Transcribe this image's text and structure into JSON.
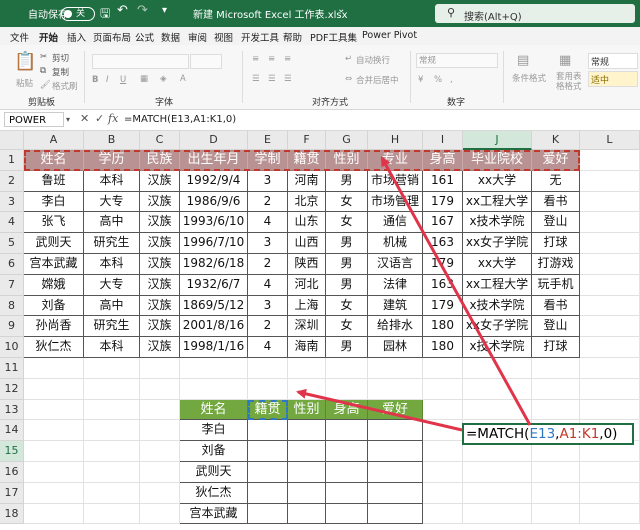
{
  "titlebar": {
    "autosave_label": "自动保存",
    "toggle_state": "关",
    "filename": "新建 Microsoft Excel 工作表.xlsx",
    "search_placeholder": "搜索(Alt+Q)"
  },
  "menu": [
    "文件",
    "开始",
    "插入",
    "页面布局",
    "公式",
    "数据",
    "审阅",
    "视图",
    "开发工具",
    "帮助",
    "PDF工具集",
    "Power Pivot"
  ],
  "ribbon": {
    "paste_label": "粘贴",
    "cut_label": "剪切",
    "copy_label": "复制",
    "format_painter_label": "格式刷",
    "clipboard_group": "剪贴板",
    "font_group": "字体",
    "align_group": "对齐方式",
    "number_group": "数字",
    "wrap_label": "自动换行",
    "merge_label": "合并后居中",
    "number_format": "常规",
    "cond_format_label": "条件格式",
    "table_format_label": "套用表格格式",
    "style_normal": "常规",
    "style_medium": "适中"
  },
  "formula_bar": {
    "name_box": "POWER",
    "formula": "=MATCH(E13,A1:K1,0)"
  },
  "columns": [
    "A",
    "B",
    "C",
    "D",
    "E",
    "F",
    "G",
    "H",
    "I",
    "J",
    "K",
    "L"
  ],
  "rows": [
    "1",
    "2",
    "3",
    "4",
    "5",
    "6",
    "7",
    "8",
    "9",
    "10",
    "11",
    "12",
    "13",
    "14",
    "15",
    "16",
    "17",
    "18"
  ],
  "table1": {
    "headers": [
      "姓名",
      "学历",
      "民族",
      "出生年月",
      "学制",
      "籍贯",
      "性别",
      "专业",
      "身高",
      "毕业院校",
      "爱好"
    ],
    "rows": [
      [
        "鲁班",
        "本科",
        "汉族",
        "1992/9/4",
        "3",
        "河南",
        "男",
        "市场营销",
        "161",
        "xx大学",
        "无"
      ],
      [
        "李白",
        "大专",
        "汉族",
        "1986/9/6",
        "2",
        "北京",
        "女",
        "市场管理",
        "179",
        "xx工程大学",
        "看书"
      ],
      [
        "张飞",
        "高中",
        "汉族",
        "1993/6/10",
        "4",
        "山东",
        "女",
        "通信",
        "167",
        "x技术学院",
        "登山"
      ],
      [
        "武则天",
        "研究生",
        "汉族",
        "1996/7/10",
        "3",
        "山西",
        "男",
        "机械",
        "163",
        "xx女子学院",
        "打球"
      ],
      [
        "宫本武藏",
        "本科",
        "汉族",
        "1982/6/18",
        "2",
        "陕西",
        "男",
        "汉语言",
        "179",
        "xx大学",
        "打游戏"
      ],
      [
        "嫦娥",
        "大专",
        "汉族",
        "1932/6/7",
        "4",
        "河北",
        "男",
        "法律",
        "163",
        "xx工程大学",
        "玩手机"
      ],
      [
        "刘备",
        "高中",
        "汉族",
        "1869/5/12",
        "3",
        "上海",
        "女",
        "建筑",
        "179",
        "x技术学院",
        "看书"
      ],
      [
        "孙尚香",
        "研究生",
        "汉族",
        "2001/8/16",
        "2",
        "深圳",
        "女",
        "给排水",
        "180",
        "xx女子学院",
        "登山"
      ],
      [
        "狄仁杰",
        "本科",
        "汉族",
        "1998/1/16",
        "4",
        "海南",
        "男",
        "园林",
        "180",
        "x技术学院",
        "打球"
      ]
    ]
  },
  "table2": {
    "headers": [
      "姓名",
      "籍贯",
      "性别",
      "身高",
      "爱好"
    ],
    "names": [
      "李白",
      "刘备",
      "武则天",
      "狄仁杰",
      "宫本武藏"
    ]
  },
  "edit_cell": {
    "prefix": "=MATCH(",
    "ref1": "E13",
    "comma": ",",
    "ref2": "A1:K1",
    "suffix": ",0)"
  },
  "colors": {
    "brand_green": "#1f6f43",
    "header_mauve": "#b99394",
    "header_green": "#72a83f",
    "arrow_red": "#e0344a"
  }
}
